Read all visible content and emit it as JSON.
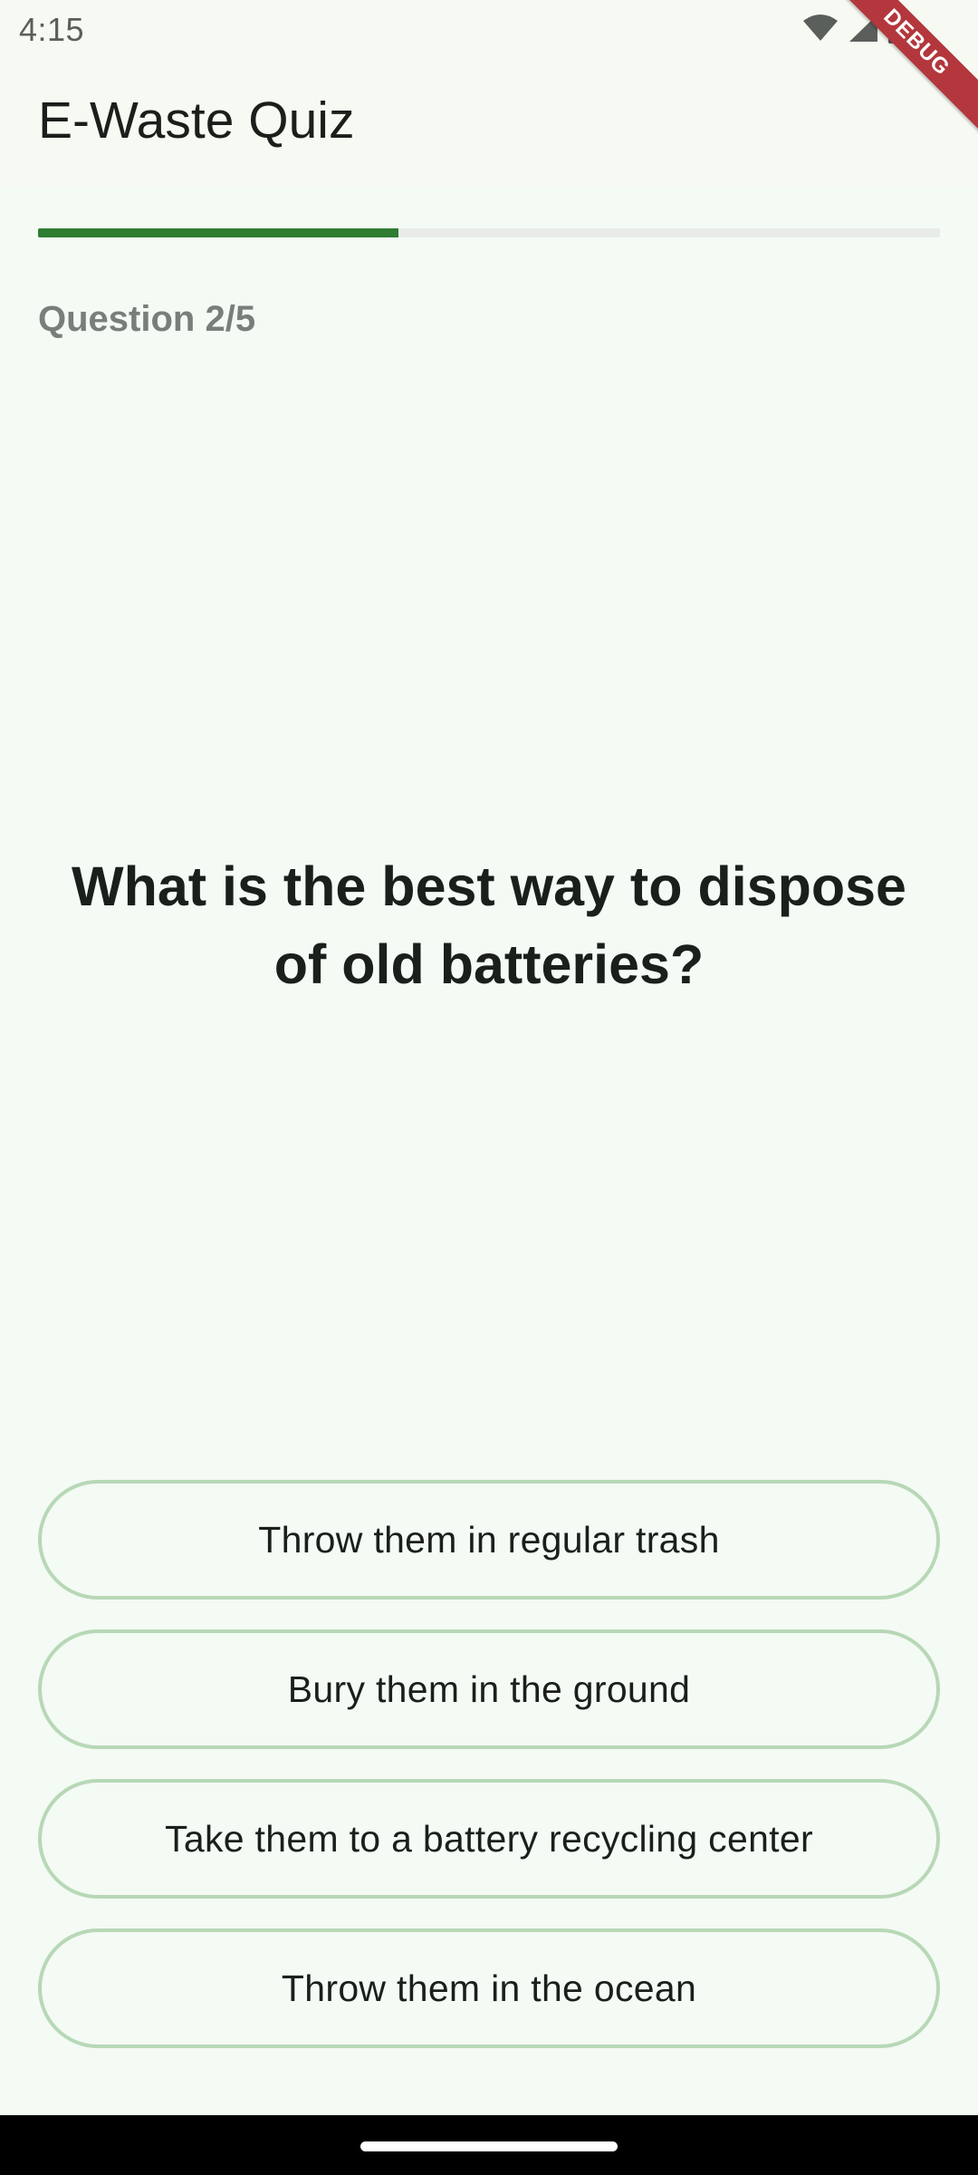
{
  "status_bar": {
    "time": "4:15",
    "icons": [
      "wifi-icon",
      "signal-icon",
      "battery-icon"
    ]
  },
  "app_bar": {
    "title": "E-Waste Quiz",
    "debug_banner": "DEBUG"
  },
  "quiz": {
    "progress_fraction": 0.4,
    "counter": "Question 2/5",
    "question": "What is the best way to dispose of old batteries?",
    "answers": [
      "Throw them in regular trash",
      "Bury them in the ground",
      "Take them to a battery recycling center",
      "Throw them in the ocean"
    ]
  },
  "colors": {
    "accent": "#2E7D32",
    "answer_border": "#B7D8B6",
    "background": "#F4FAF4"
  }
}
